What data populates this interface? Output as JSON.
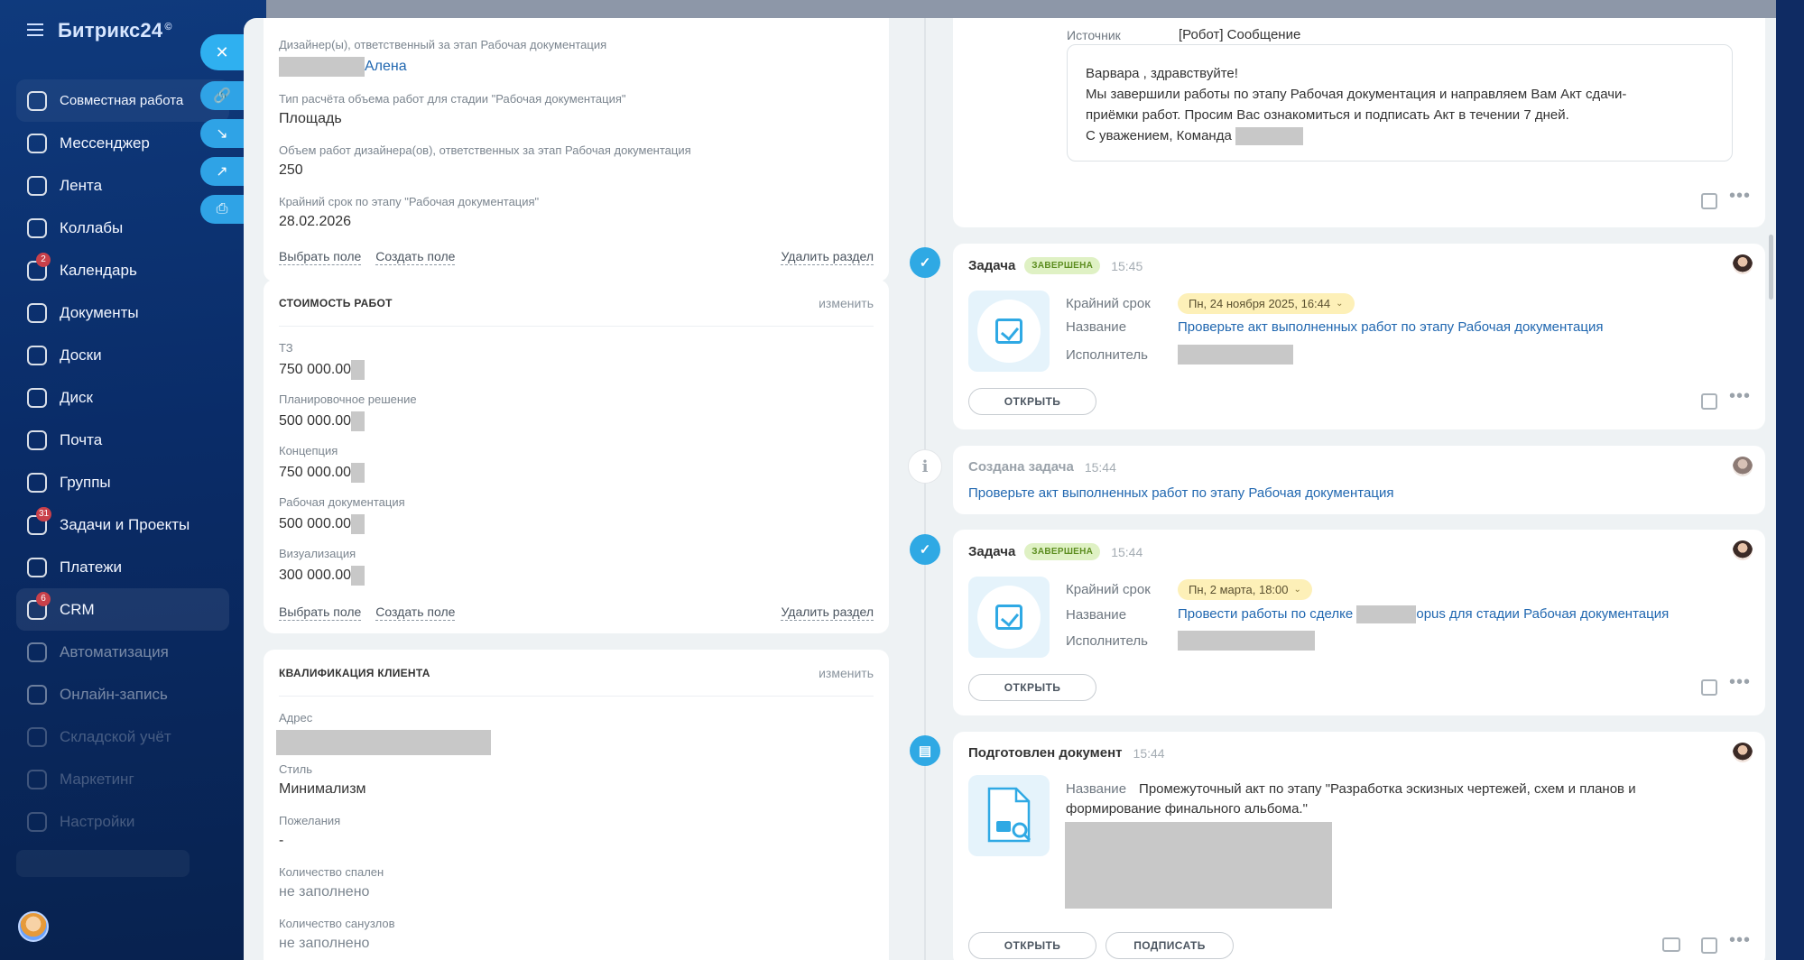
{
  "app": {
    "logo": "Битрикс24",
    "logo_mark": "©"
  },
  "sidebar": {
    "items": [
      {
        "label": "Совместная работа",
        "icon": "collab-icon",
        "state": "first"
      },
      {
        "label": "Мессенджер",
        "icon": "chat-icon"
      },
      {
        "label": "Лента",
        "icon": "feed-icon"
      },
      {
        "label": "Коллабы",
        "icon": "collabs-icon"
      },
      {
        "label": "Календарь",
        "icon": "calendar-icon",
        "badge": "2"
      },
      {
        "label": "Документы",
        "icon": "documents-icon"
      },
      {
        "label": "Доски",
        "icon": "boards-icon"
      },
      {
        "label": "Диск",
        "icon": "disk-icon"
      },
      {
        "label": "Почта",
        "icon": "mail-icon"
      },
      {
        "label": "Группы",
        "icon": "groups-icon"
      },
      {
        "label": "Задачи и Проекты",
        "icon": "tasks-icon",
        "badge": "31"
      },
      {
        "label": "Платежи",
        "icon": "payments-icon"
      },
      {
        "label": "CRM",
        "icon": "crm-icon",
        "badge": "6",
        "state": "active"
      },
      {
        "label": "Автоматизация",
        "icon": "automation-icon",
        "state": "dim"
      },
      {
        "label": "Онлайн-запись",
        "icon": "booking-icon",
        "state": "dim"
      },
      {
        "label": "Складской учёт",
        "icon": "inventory-icon",
        "state": "faint"
      },
      {
        "label": "Маркетинг",
        "icon": "marketing-icon",
        "state": "faint"
      },
      {
        "label": "Настройки",
        "icon": "settings-icon",
        "state": "faint"
      }
    ]
  },
  "slider_actions": {
    "close": "✕",
    "link": "🔗",
    "minimize": "↘",
    "open_new": "↗",
    "print": "⎙"
  },
  "left": {
    "card1": {
      "designer_label": "Дизайнер(ы), ответственный за этап Рабочая документация",
      "designer_value": "Алена",
      "calc_type_label": "Тип расчёта объема работ для стадии \"Рабочая документация\"",
      "calc_type_value": "Площадь",
      "volume_label": "Объем работ дизайнера(ов), ответственных за этап Рабочая документация",
      "volume_value": "250",
      "deadline_label": "Крайний срок по этапу \"Рабочая документация\"",
      "deadline_value": "28.02.2026",
      "choose_field": "Выбрать поле",
      "create_field": "Создать поле",
      "delete_section": "Удалить раздел"
    },
    "cost": {
      "title": "СТОИМОСТЬ РАБОТ",
      "edit": "изменить",
      "fields": [
        {
          "label": "ТЗ",
          "value": "750 000.00"
        },
        {
          "label": "Планировочное решение",
          "value": "500 000.00"
        },
        {
          "label": "Концепция",
          "value": "750 000.00"
        },
        {
          "label": "Рабочая документация",
          "value": "500 000.00"
        },
        {
          "label": "Визуализация",
          "value": "300 000.00"
        }
      ],
      "choose_field": "Выбрать поле",
      "create_field": "Создать поле",
      "delete_section": "Удалить раздел"
    },
    "qual": {
      "title": "КВАЛИФИКАЦИЯ КЛИЕНТА",
      "edit": "изменить",
      "address_label": "Адрес",
      "style_label": "Стиль",
      "style_value": "Минимализм",
      "wishes_label": "Пожелания",
      "wishes_value": "-",
      "bedrooms_label": "Количество спален",
      "bedrooms_value": "не заполнено",
      "bathrooms_label": "Количество санузлов",
      "bathrooms_value": "не заполнено"
    }
  },
  "timeline": {
    "message": {
      "source_label": "Источник",
      "source_value": "[Робот] Сообщение",
      "line1": "Варвара , здравствуйте!",
      "line2": "Мы завершили работы по этапу Рабочая документация и направляем Вам Акт сдачи-",
      "line3": "приёмки работ. Просим Вас ознакомиться и подписать Акт в течении 7 дней.",
      "line4": "С уважением, Команда"
    },
    "task1": {
      "title": "Задача",
      "status": "ЗАВЕРШЕНА",
      "time": "15:45",
      "deadline_label": "Крайний срок",
      "deadline_value": "Пн, 24 ноября 2025, 16:44",
      "name_label": "Название",
      "name_value": "Проверьте акт выполненных работ по этапу Рабочая документация",
      "assignee_label": "Исполнитель",
      "open": "ОТКРЫТЬ"
    },
    "created": {
      "title": "Создана задача",
      "time": "15:44",
      "link": "Проверьте акт выполненных работ по этапу Рабочая документация"
    },
    "task2": {
      "title": "Задача",
      "status": "ЗАВЕРШЕНА",
      "time": "15:44",
      "deadline_label": "Крайний срок",
      "deadline_value": "Пн, 2 марта, 18:00",
      "name_label": "Название",
      "name_prefix": "Провести работы по сделке",
      "name_suffix": "opus для стадии Рабочая документация",
      "assignee_label": "Исполнитель",
      "open": "ОТКРЫТЬ"
    },
    "doc": {
      "title": "Подготовлен документ",
      "time": "15:44",
      "name_label": "Название",
      "name_value": "Промежуточный акт по этапу \"Разработка эскизных чертежей, схем и планов и",
      "name_value2": "формирование финального альбома.\"",
      "open": "ОТКРЫТЬ",
      "sign": "ПОДПИСАТЬ"
    }
  },
  "colors": {
    "accent": "#2fa9e4",
    "sidebar": "#0f3a7d",
    "link": "#2067b0",
    "done_badge": "#dff1c4"
  }
}
